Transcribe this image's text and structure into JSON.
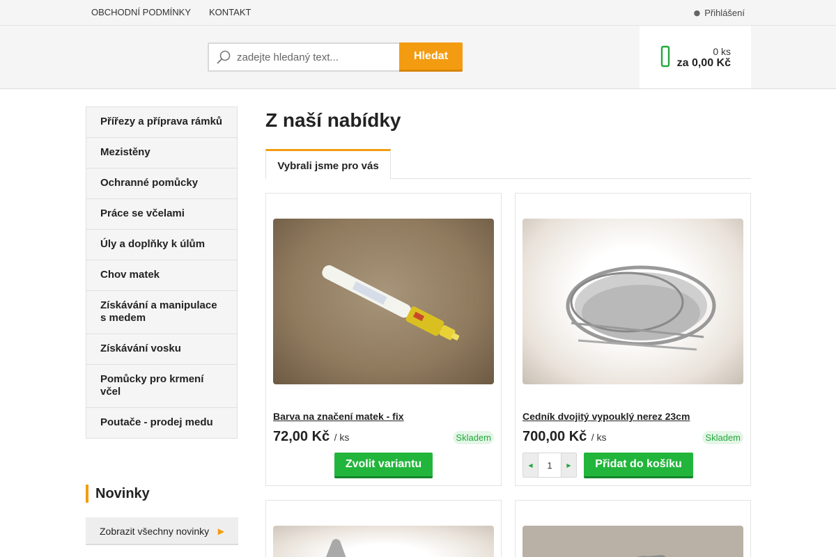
{
  "topbar": {
    "links": [
      "OBCHODNÍ PODMÍNKY",
      "KONTAKT"
    ],
    "login_label": "Přihlášení",
    "login_icon": "user-icon"
  },
  "header": {
    "search_placeholder": "zadejte hledaný text...",
    "search_value": "",
    "search_button": "Hledat",
    "cart_icon": "cart-icon",
    "cart_count": "0 ks",
    "cart_total": "za 0,00 Kč"
  },
  "sidebar": {
    "categories": [
      "Přířezy a příprava rámků",
      "Mezistěny",
      "Ochranné pomůcky",
      "Práce se včelami",
      "Úly a doplňky k úlům",
      "Chov matek",
      "Získávání a manipulace s medem",
      "Získávání vosku",
      "Pomůcky pro krmení včel",
      "Poutače - prodej medu"
    ],
    "novinky_title": "Novinky",
    "novinky_link": "Zobrazit všechny novinky"
  },
  "main": {
    "title": "Z naší nabídky",
    "tab_label": "Vybrali jsme pro vás",
    "products": [
      {
        "name": "Barva na značení matek - fix",
        "price": "72,00 Kč",
        "unit": "/ ks",
        "stock": "Skladem",
        "button": "Zvolit variantu"
      },
      {
        "name": "Cedník dvojitý vypouklý nerez 23cm",
        "price": "700,00 Kč",
        "unit": "/ ks",
        "stock": "Skladem",
        "quantity": "1",
        "button": "Přidat do košíku"
      }
    ]
  },
  "colors": {
    "accent": "#f39c12",
    "green": "#22b53c",
    "stock_bg": "#e4f6e7"
  }
}
